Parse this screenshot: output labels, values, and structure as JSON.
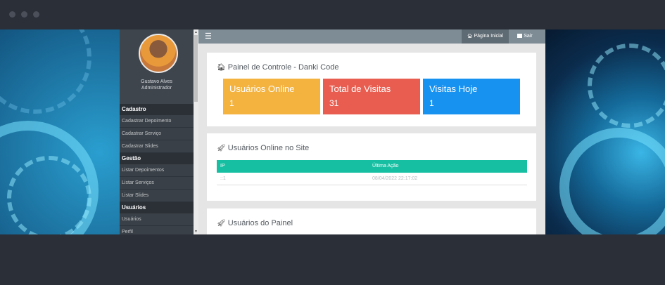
{
  "sidebar": {
    "user_name": "Gustavo Alves",
    "user_role": "Administrador",
    "groups": [
      {
        "title": "Cadastro",
        "items": [
          "Cadastrar Depoimento",
          "Cadastrar Serviço",
          "Cadastrar Slides"
        ]
      },
      {
        "title": "Gestão",
        "items": [
          "Listar Depoimentos",
          "Listar Serviços",
          "Listar Slides"
        ]
      },
      {
        "title": "Usuários",
        "items": [
          "Usuários",
          "Perfil"
        ]
      }
    ]
  },
  "topbar": {
    "menu_icon": "☰",
    "home_label": "Página Inicial",
    "exit_label": "Sair"
  },
  "dashboard": {
    "title": "Painel de Controle - Danki Code",
    "cards": [
      {
        "label": "Usuários Online",
        "value": "1",
        "color": "#f4b23f"
      },
      {
        "label": "Total de Visitas",
        "value": "31",
        "color": "#e85d50"
      },
      {
        "label": "Visitas Hoje",
        "value": "1",
        "color": "#1792f0"
      }
    ]
  },
  "online_users": {
    "title": "Usuários Online no Site",
    "headers": [
      "IP",
      "Última Ação"
    ],
    "rows": [
      {
        "ip": "::1",
        "last_action": "08/04/2022 22:17:02"
      }
    ]
  },
  "panel_users": {
    "title": "Usuários do Painel"
  },
  "colors": {
    "table_header": "#16bfa2",
    "topbar": "#7e8c96",
    "sidebar": "#353b43"
  }
}
